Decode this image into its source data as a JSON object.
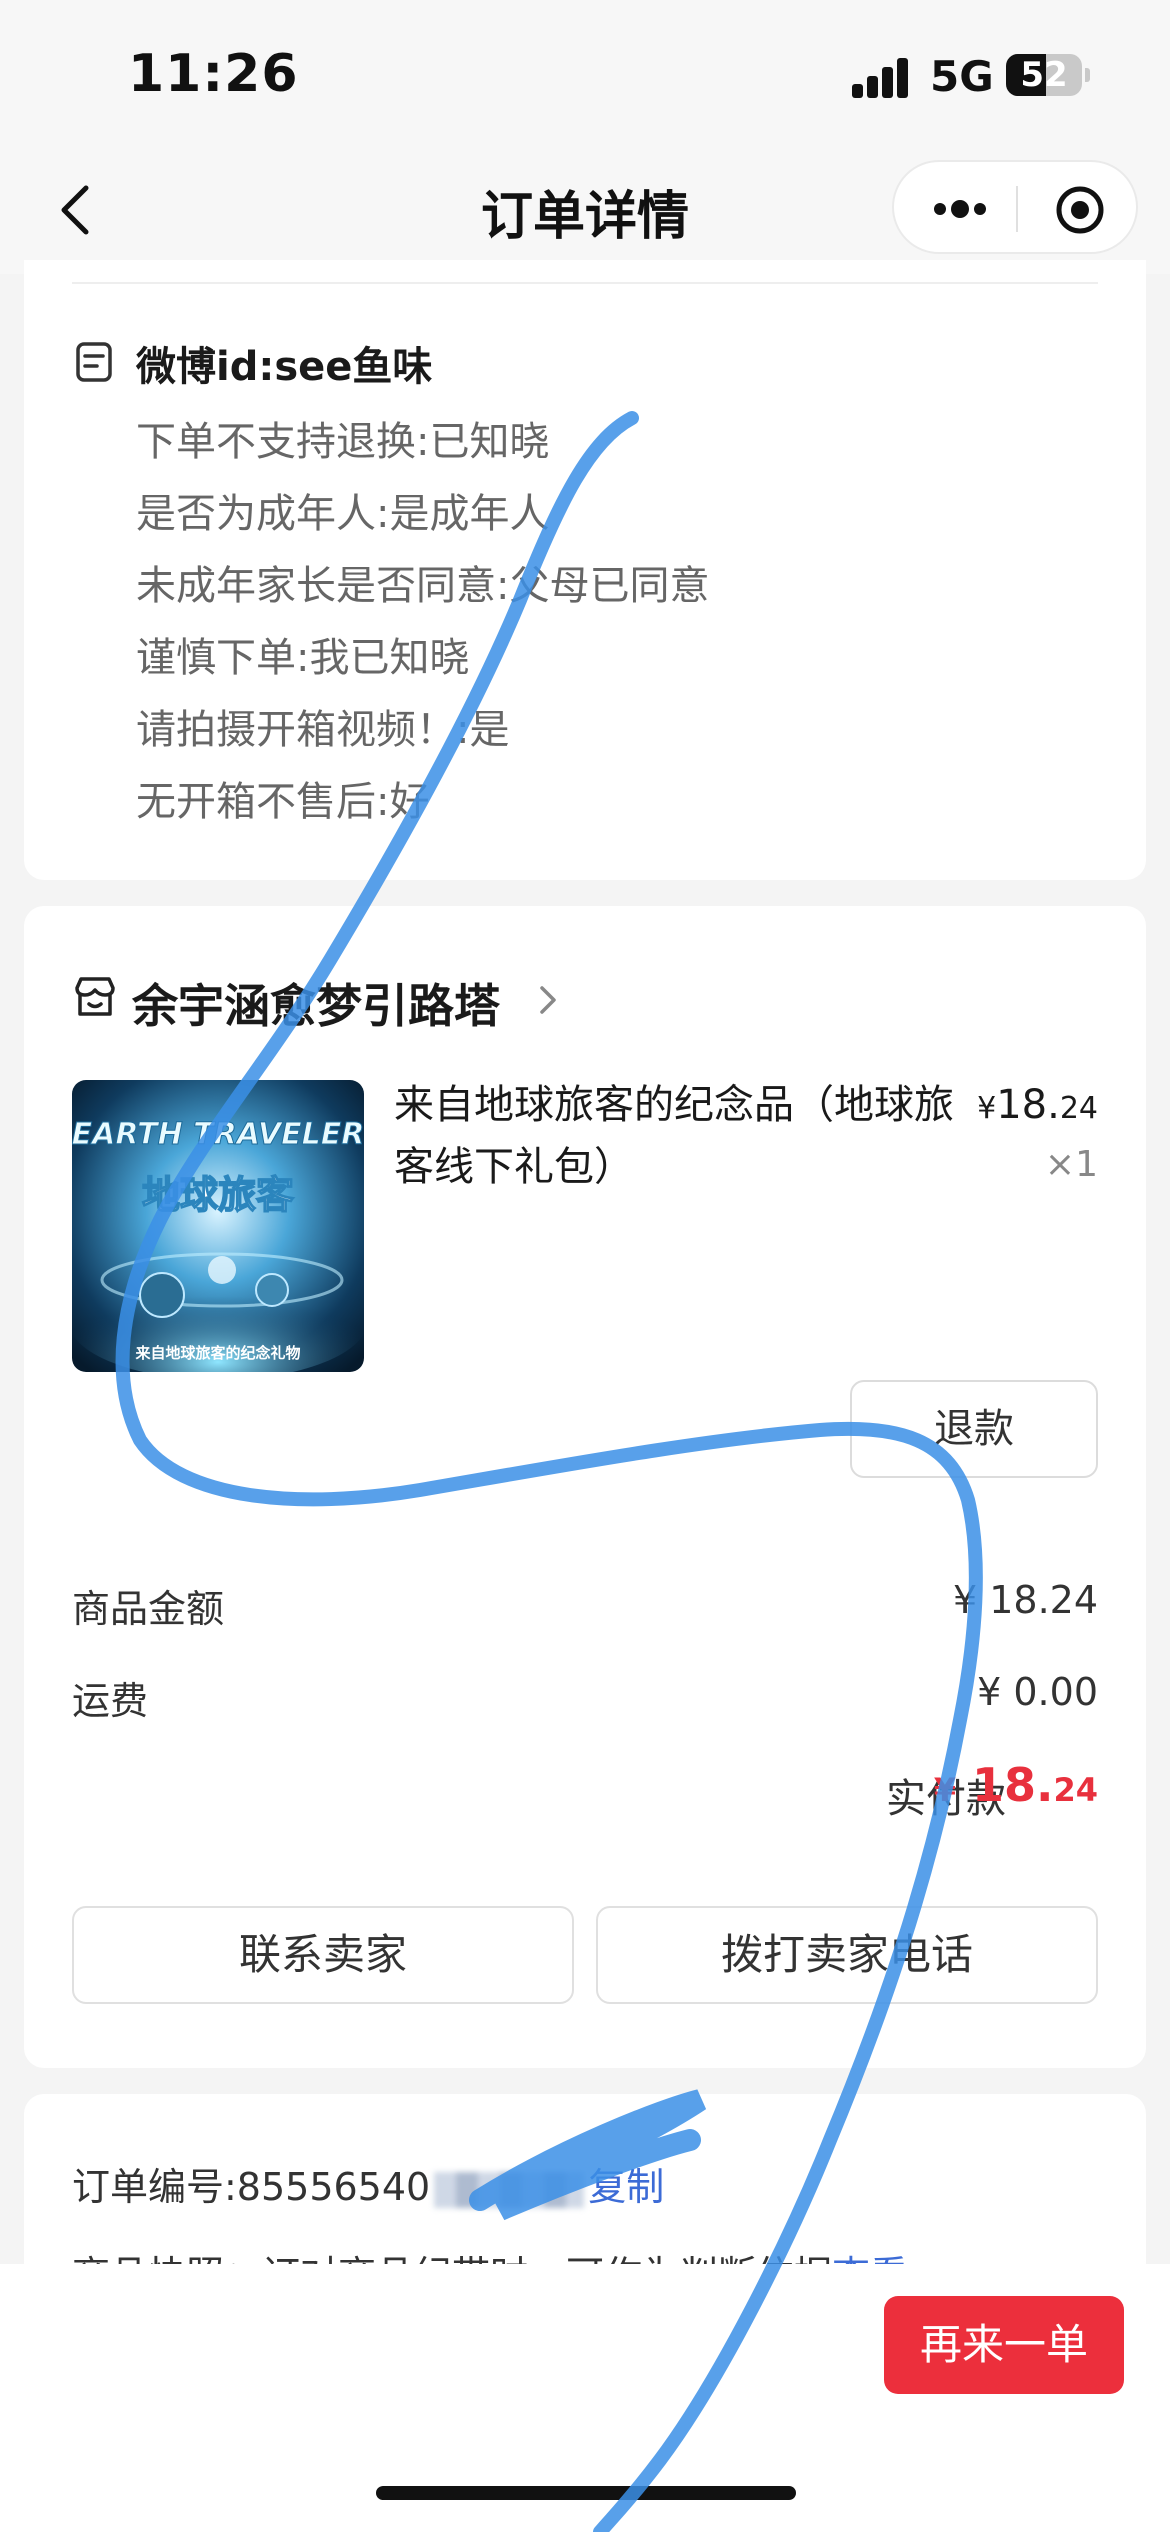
{
  "status_bar": {
    "time": "11:26",
    "network": "5G",
    "battery": "52",
    "battery_level": 0.52
  },
  "nav": {
    "title": "订单详情",
    "back_icon": "chevron-left-icon",
    "more_icon": "more-dots-icon",
    "close_icon": "target-circle-icon"
  },
  "remarks": {
    "icon": "note-icon",
    "title": "微博id:see鱼味",
    "lines": [
      "下单不支持退换:已知晓",
      "是否为成年人:是成年人",
      "未成年家长是否同意:父母已同意",
      "谨慎下单:我已知晓",
      "请拍摄开箱视频！:是",
      "无开箱不售后:好"
    ]
  },
  "order": {
    "shop_icon": "store-icon",
    "shop_name": "余宇涵愈梦引路塔",
    "product": {
      "title": "来自地球旅客的纪念品（地球旅客线下礼包）",
      "price_symbol": "¥",
      "price_int": "18.",
      "price_dec": "24",
      "qty": "×1",
      "thumb": {
        "title_en": "EARTH TRAVELER",
        "title_cn": "地球旅客",
        "caption": "来自地球旅客的纪念礼物"
      }
    },
    "refund_label": "退款",
    "goods_amount_label": "商品金额",
    "goods_amount_value": "¥ 18.24",
    "shipping_label": "运费",
    "shipping_value": "¥ 0.00",
    "paid_label": "实付款",
    "paid_symbol": "¥",
    "paid_int": "18.",
    "paid_dec": "24",
    "contact_seller_label": "联系卖家",
    "call_seller_label": "拨打卖家电话"
  },
  "info": {
    "order_no_label": "订单编号:85556540",
    "copy_label": "复制",
    "snapshot_label": "商品快照：订对商品纪带时，可作为判断依据",
    "snapshot_link": "查看"
  },
  "bottom": {
    "reorder_label": "再来一单"
  },
  "colors": {
    "accent_red": "#ec2f3c",
    "price_red": "#e8303d",
    "link_blue": "#3c6bd6",
    "scribble_blue": "#3b8fe6"
  }
}
